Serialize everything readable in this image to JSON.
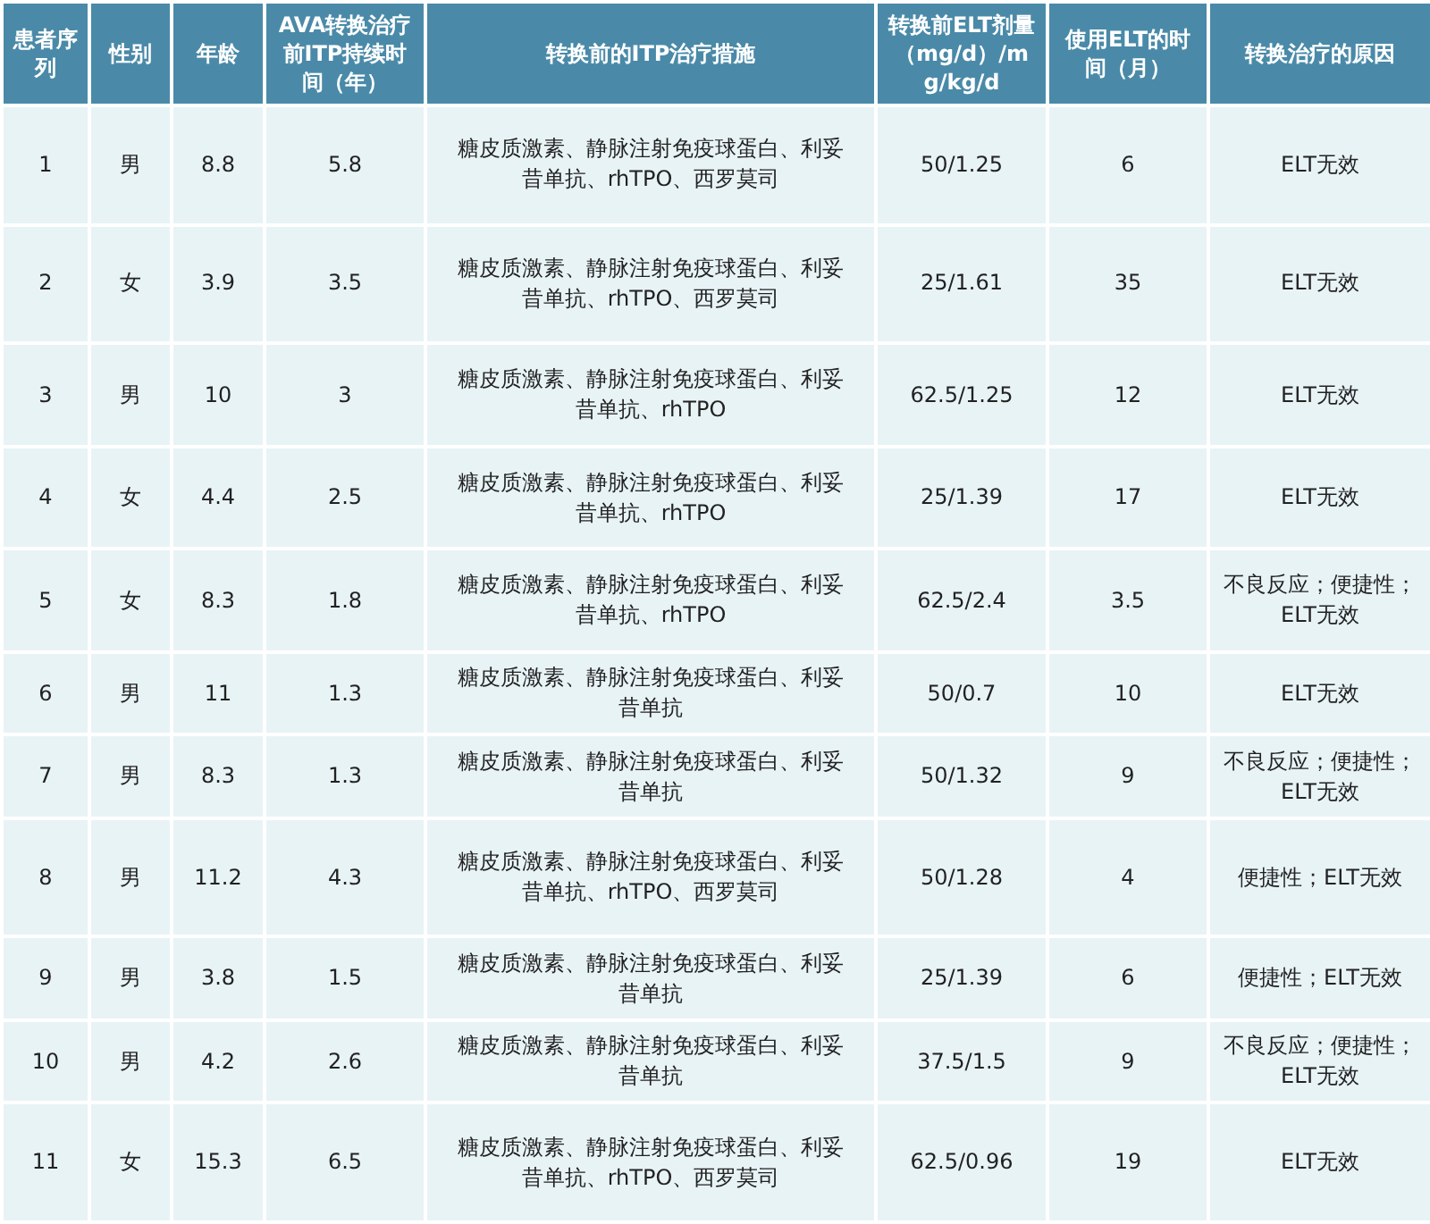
{
  "table": {
    "columns": [
      "患者序列",
      "性别",
      "年龄",
      "AVA转换治疗前ITP持续时间（年）",
      "转换前的ITP治疗措施",
      "转换前ELT剂量（mg/d）/mg/kg/d",
      "使用ELT的时间（月）",
      "转换治疗的原因"
    ],
    "rows": [
      [
        "1",
        "男",
        "8.8",
        "5.8",
        "糖皮质激素、静脉注射免疫球蛋白、利妥昔单抗、rhTPO、西罗莫司",
        "50/1.25",
        "6",
        "ELT无效"
      ],
      [
        "2",
        "女",
        "3.9",
        "3.5",
        "糖皮质激素、静脉注射免疫球蛋白、利妥昔单抗、rhTPO、西罗莫司",
        "25/1.61",
        "35",
        "ELT无效"
      ],
      [
        "3",
        "男",
        "10",
        "3",
        "糖皮质激素、静脉注射免疫球蛋白、利妥昔单抗、rhTPO",
        "62.5/1.25",
        "12",
        "ELT无效"
      ],
      [
        "4",
        "女",
        "4.4",
        "2.5",
        "糖皮质激素、静脉注射免疫球蛋白、利妥昔单抗、rhTPO",
        "25/1.39",
        "17",
        "ELT无效"
      ],
      [
        "5",
        "女",
        "8.3",
        "1.8",
        "糖皮质激素、静脉注射免疫球蛋白、利妥昔单抗、rhTPO",
        "62.5/2.4",
        "3.5",
        "不良反应；便捷性；ELT无效"
      ],
      [
        "6",
        "男",
        "11",
        "1.3",
        "糖皮质激素、静脉注射免疫球蛋白、利妥昔单抗",
        "50/0.7",
        "10",
        "ELT无效"
      ],
      [
        "7",
        "男",
        "8.3",
        "1.3",
        "糖皮质激素、静脉注射免疫球蛋白、利妥昔单抗",
        "50/1.32",
        "9",
        "不良反应；便捷性；ELT无效"
      ],
      [
        "8",
        "男",
        "11.2",
        "4.3",
        "糖皮质激素、静脉注射免疫球蛋白、利妥昔单抗、rhTPO、西罗莫司",
        "50/1.28",
        "4",
        "便捷性；ELT无效"
      ],
      [
        "9",
        "男",
        "3.8",
        "1.5",
        "糖皮质激素、静脉注射免疫球蛋白、利妥昔单抗",
        "25/1.39",
        "6",
        "便捷性；ELT无效"
      ],
      [
        "10",
        "男",
        "4.2",
        "2.6",
        "糖皮质激素、静脉注射免疫球蛋白、利妥昔单抗",
        "37.5/1.5",
        "9",
        "不良反应；便捷性；ELT无效"
      ],
      [
        "11",
        "女",
        "15.3",
        "6.5",
        "糖皮质激素、静脉注射免疫球蛋白、利妥昔单抗、rhTPO、西罗莫司",
        "62.5/0.96",
        "19",
        "ELT无效"
      ]
    ]
  }
}
